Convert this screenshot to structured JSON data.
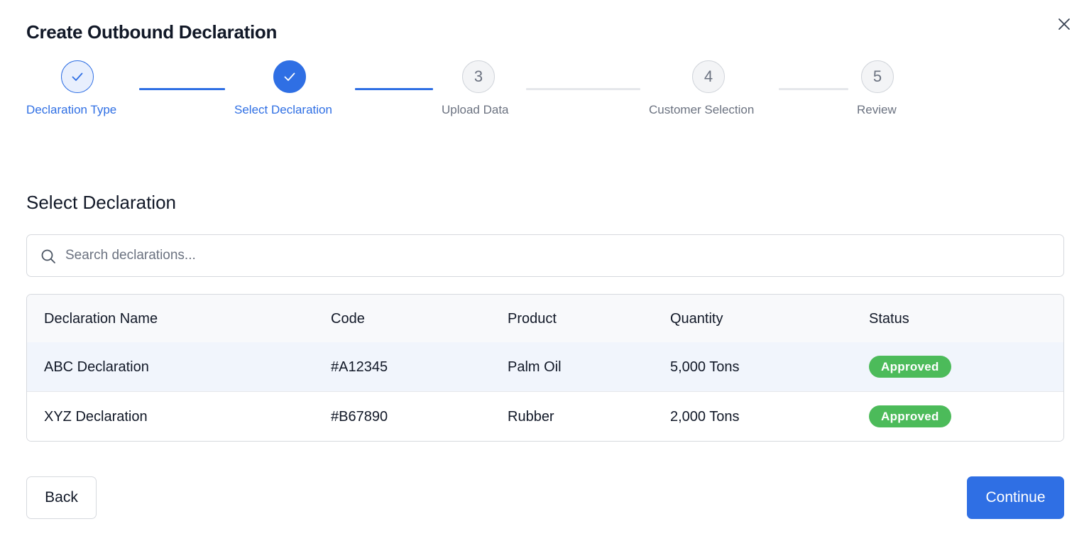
{
  "dialog": {
    "title": "Create Outbound Declaration",
    "close_icon": "close-icon"
  },
  "stepper": {
    "steps": [
      {
        "number": "1",
        "label": "Declaration Type",
        "state": "completed",
        "icon": "check-icon"
      },
      {
        "number": "2",
        "label": "Select Declaration",
        "state": "current",
        "icon": "check-icon"
      },
      {
        "number": "3",
        "label": "Upload Data",
        "state": "pending"
      },
      {
        "number": "4",
        "label": "Customer Selection",
        "state": "pending"
      },
      {
        "number": "5",
        "label": "Review",
        "state": "pending"
      }
    ]
  },
  "section": {
    "title": "Select Declaration"
  },
  "search": {
    "placeholder": "Search declarations...",
    "value": "",
    "icon": "search-icon"
  },
  "table": {
    "columns": [
      "Declaration Name",
      "Code",
      "Product",
      "Quantity",
      "Status"
    ],
    "rows": [
      {
        "name": "ABC Declaration",
        "code": "#A12345",
        "product": "Palm Oil",
        "quantity": "5,000 Tons",
        "status": "Approved",
        "selected": true
      },
      {
        "name": "XYZ Declaration",
        "code": "#B67890",
        "product": "Rubber",
        "quantity": "2,000 Tons",
        "status": "Approved",
        "selected": false
      }
    ]
  },
  "footer": {
    "back_label": "Back",
    "continue_label": "Continue"
  },
  "colors": {
    "primary": "#2f6fe4",
    "approved_badge": "#4cbb5a",
    "selected_row": "#f1f5fc",
    "muted_text": "#6b7280"
  }
}
